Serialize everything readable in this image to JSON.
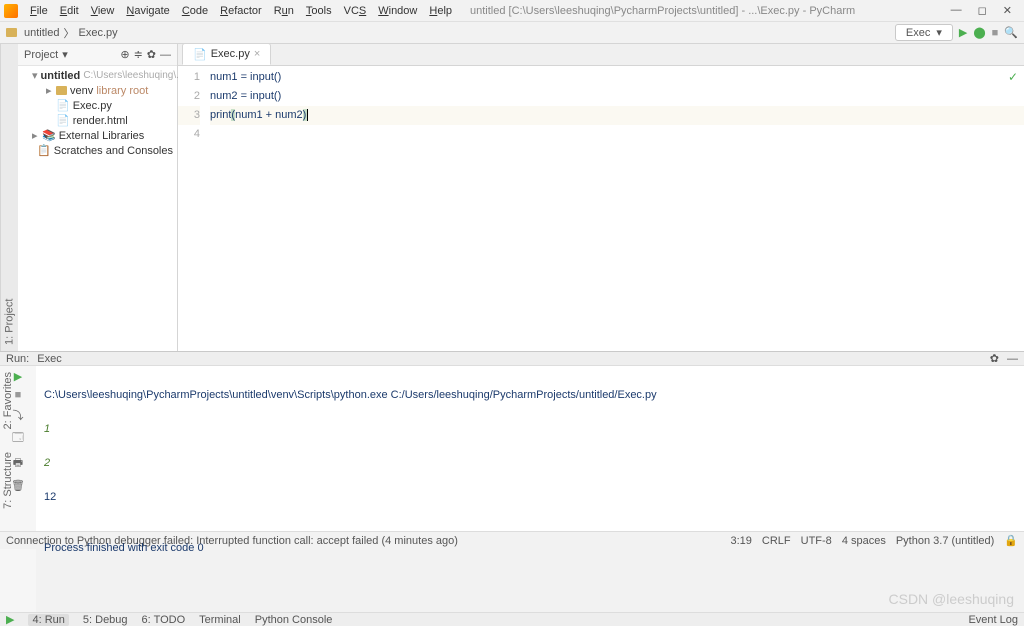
{
  "menu": {
    "items": [
      "File",
      "Edit",
      "View",
      "Navigate",
      "Code",
      "Refactor",
      "Run",
      "Tools",
      "VCS",
      "Window",
      "Help"
    ],
    "title": "untitled [C:\\Users\\leeshuqing\\PycharmProjects\\untitled] - ...\\Exec.py - PyCharm"
  },
  "window_controls": {
    "min": "—",
    "max": "◻",
    "close": "✕"
  },
  "navbar": {
    "crumb1": "untitled",
    "crumb2": "Exec.py",
    "run_config": "Exec",
    "icons": {
      "play": "▶",
      "bug": "⬤",
      "stop": "■",
      "cont": "⟳",
      "find": "🔍"
    }
  },
  "project": {
    "header": "Project",
    "root": "untitled",
    "root_path": "C:\\Users\\leeshuqing\\...",
    "venv": "venv",
    "venv_note": "library root",
    "exec": "Exec.py",
    "render": "render.html",
    "ext": "External Libraries",
    "scratch": "Scratches and Consoles"
  },
  "editor": {
    "tab": "Exec.py",
    "lines": [
      "num1 = input()",
      "num2 = input()",
      "print(num1 + num2)",
      ""
    ]
  },
  "run": {
    "title": "Run:",
    "config": "Exec",
    "out_cmd": "C:\\Users\\leeshuqing\\PycharmProjects\\untitled\\venv\\Scripts\\python.exe C:/Users/leeshuqing/PycharmProjects/untitled/Exec.py",
    "in1": "1",
    "in2": "2",
    "out": "12",
    "exit": "Process finished with exit code 0"
  },
  "bottom_tabs": {
    "run": "4: Run",
    "debug": "5: Debug",
    "todo": "6: TODO",
    "terminal": "Terminal",
    "pyconsole": "Python Console",
    "log": "Event Log"
  },
  "status": {
    "msg": "Connection to Python debugger failed: Interrupted function call: accept failed (4 minutes ago)",
    "pos": "3:19",
    "sep": "CRLF",
    "enc": "UTF-8",
    "indent": "4 spaces",
    "interp": "Python 3.7 (untitled)",
    "lock": "🔒"
  },
  "watermark": "CSDN @leeshuqing",
  "left_stripe": {
    "proj": "1: Project",
    "struct": "7: Structure",
    "fav": "2: Favorites"
  }
}
